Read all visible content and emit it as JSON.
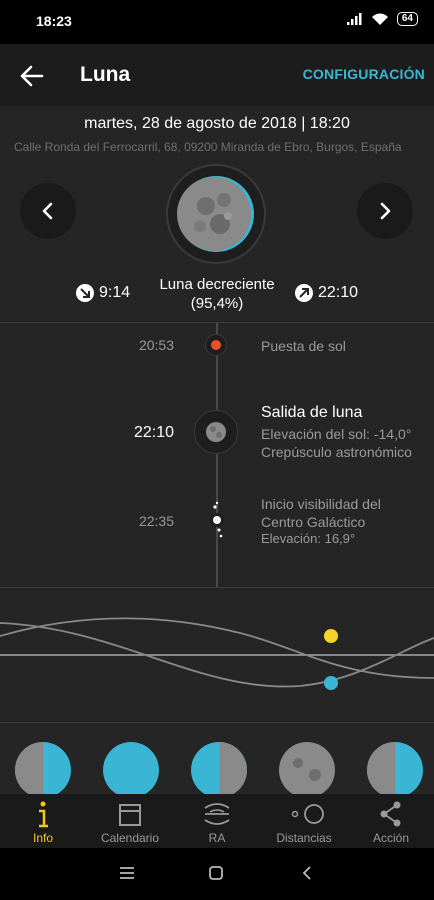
{
  "status_bar": {
    "time": "18:23",
    "battery": "64"
  },
  "app_bar": {
    "title": "Luna",
    "config_label": "CONFIGURACIÓN"
  },
  "header": {
    "date": "martes, 28 de agosto de 2018 | 18:20",
    "address": "Calle Ronda del Ferrocarril, 68, 09200 Miranda de Ebro, Burgos, España",
    "phase_name": "Luna decreciente",
    "phase_pct": "(95,4%)",
    "moonset_time": "9:14",
    "moonrise_time": "22:10"
  },
  "timeline": {
    "events": [
      {
        "time": "20:53",
        "title": "Puesta de sol",
        "lines": []
      },
      {
        "time": "22:10",
        "title": "Salida de luna",
        "lines": [
          "Elevación del sol: -14,0°",
          "Crepúsculo astronómico"
        ]
      },
      {
        "time": "22:35",
        "title": "Inicio visibilidad del",
        "lines": [
          "Centro Galáctico",
          "Elevación: 16,9°"
        ]
      }
    ]
  },
  "tabs": [
    {
      "label": "Info",
      "icon": "info-icon"
    },
    {
      "label": "Calendario",
      "icon": "calendar-icon"
    },
    {
      "label": "RA",
      "icon": "ar-icon"
    },
    {
      "label": "Distancias",
      "icon": "distances-icon"
    },
    {
      "label": "Acción",
      "icon": "share-icon"
    }
  ],
  "colors": {
    "accent": "#3ab6d4",
    "active_tab": "#f5c518",
    "sun": "#f5d327",
    "moon_dot": "#3ab6d4",
    "sunset": "#e8502a",
    "header_bg": "#252525"
  }
}
